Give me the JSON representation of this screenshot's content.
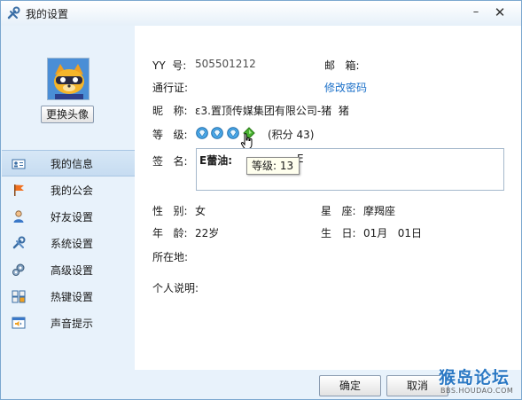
{
  "window": {
    "title": "我的设置"
  },
  "sidebar": {
    "change_avatar": "更换头像",
    "items": [
      {
        "label": "我的信息",
        "icon": "id-card-icon",
        "active": true
      },
      {
        "label": "我的公会",
        "icon": "flag-icon",
        "active": false
      },
      {
        "label": "好友设置",
        "icon": "person-icon",
        "active": false
      },
      {
        "label": "系统设置",
        "icon": "tools-icon",
        "active": false
      },
      {
        "label": "高级设置",
        "icon": "gears-icon",
        "active": false
      },
      {
        "label": "热键设置",
        "icon": "keyboard-icon",
        "active": false
      },
      {
        "label": "声音提示",
        "icon": "speaker-window-icon",
        "active": false
      }
    ]
  },
  "profile": {
    "yy_label": "YY  号:",
    "yy_value": "505501212",
    "email_label": "邮   箱:",
    "email_value": "",
    "passport_label": "通行证:",
    "change_password": "修改密码",
    "nickname_label": "昵   称:",
    "nickname_value": "ε3.置顶传媒集团有限公司-猪  猪",
    "level_label": "等   级:",
    "points_text": "(积分 43)",
    "signature_label": "签   名:",
    "signature_value": "E蕾油:",
    "signature_tail": "E",
    "tooltip": "等级: 13",
    "gender_label": "性   别:",
    "gender_value": "女",
    "zodiac_label": "星   座:",
    "zodiac_value": "摩羯座",
    "age_label": "年   龄:",
    "age_value": "22岁",
    "birthday_label": "生   日:",
    "birthday_value": "01月   01日",
    "location_label": "所在地:",
    "bio_label": "个人说明:"
  },
  "footer": {
    "ok": "确定",
    "cancel": "取消"
  },
  "watermark": {
    "main": "猴岛论坛",
    "sub": "BBS.HOUDAO.COM"
  },
  "colors": {
    "accent": "#1a6fc8",
    "sidebar_bg": "#e8f2fb",
    "gem": "#4aa8e8"
  }
}
